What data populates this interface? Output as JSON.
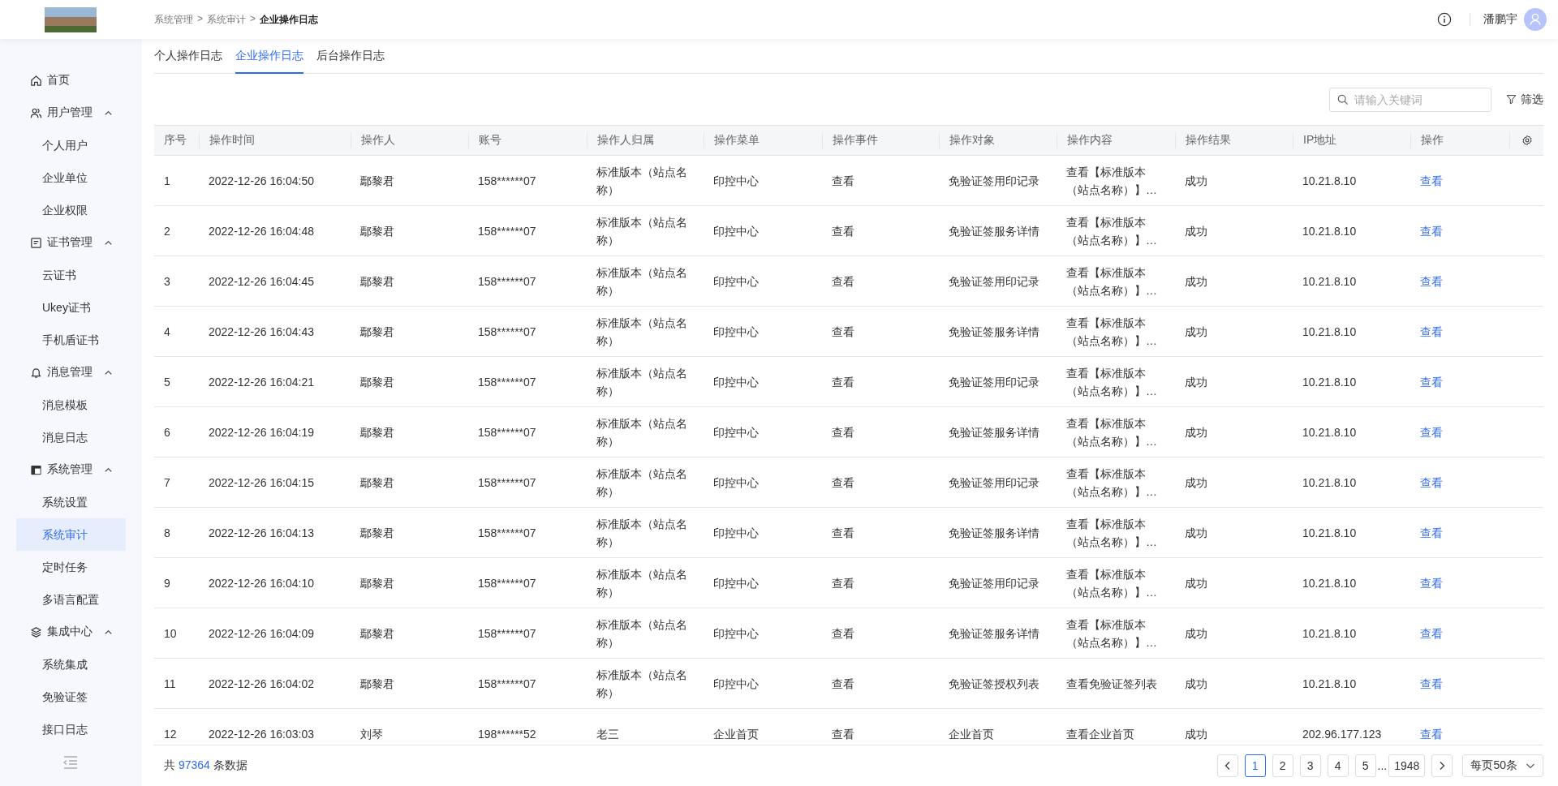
{
  "header": {
    "breadcrumb": [
      {
        "kind": "link",
        "label": "系统管理"
      },
      {
        "kind": "separator",
        "label": ">"
      },
      {
        "kind": "link",
        "label": "系统审计"
      },
      {
        "kind": "separator",
        "label": ">"
      },
      {
        "kind": "current",
        "label": "企业操作日志"
      }
    ],
    "user_name": "潘鹏宇"
  },
  "sidebar": {
    "items": [
      {
        "label": "首页",
        "selected": false
      },
      {
        "label": "用户管理",
        "expanded": true,
        "selected": false,
        "children": [
          {
            "label": "个人用户",
            "selected": false
          },
          {
            "label": "企业单位",
            "selected": false
          },
          {
            "label": "企业权限",
            "selected": false
          }
        ]
      },
      {
        "label": "证书管理",
        "expanded": true,
        "selected": false,
        "children": [
          {
            "label": "云证书",
            "selected": false
          },
          {
            "label": "Ukey证书",
            "selected": false
          },
          {
            "label": "手机盾证书",
            "selected": false
          }
        ]
      },
      {
        "label": "消息管理",
        "expanded": true,
        "selected": false,
        "children": [
          {
            "label": "消息模板",
            "selected": false
          },
          {
            "label": "消息日志",
            "selected": false
          }
        ]
      },
      {
        "label": "系统管理",
        "expanded": true,
        "selected": false,
        "children": [
          {
            "label": "系统设置",
            "selected": false
          },
          {
            "label": "系统审计",
            "selected": true
          },
          {
            "label": "定时任务",
            "selected": false
          },
          {
            "label": "多语言配置",
            "selected": false
          }
        ]
      },
      {
        "label": "集成中心",
        "expanded": true,
        "selected": false,
        "children": [
          {
            "label": "系统集成",
            "selected": false
          },
          {
            "label": "免验证签",
            "selected": false
          },
          {
            "label": "接口日志",
            "selected": false
          }
        ]
      }
    ]
  },
  "tabs": [
    {
      "label": "个人操作日志",
      "selected": false
    },
    {
      "label": "企业操作日志",
      "selected": true
    },
    {
      "label": "后台操作日志",
      "selected": false
    }
  ],
  "search": {
    "placeholder": "请输入关键词"
  },
  "filter_label": "筛选",
  "table": {
    "columns": [
      "序号",
      "操作时间",
      "操作人",
      "账号",
      "操作人归属",
      "操作菜单",
      "操作事件",
      "操作对象",
      "操作内容",
      "操作结果",
      "IP地址",
      "操作"
    ],
    "rows": [
      {
        "cells": [
          "1",
          "2022-12-26 16:04:50",
          "鄢黎君",
          "158******07",
          "标准版本（站点名称）",
          "印控中心",
          "查看",
          "免验证签用印记录",
          "查看【标准版本（站点名称）】…",
          "成功",
          "10.21.8.10"
        ],
        "action": "查看"
      },
      {
        "cells": [
          "2",
          "2022-12-26 16:04:48",
          "鄢黎君",
          "158******07",
          "标准版本（站点名称）",
          "印控中心",
          "查看",
          "免验证签服务详情",
          "查看【标准版本（站点名称）】…",
          "成功",
          "10.21.8.10"
        ],
        "action": "查看"
      },
      {
        "cells": [
          "3",
          "2022-12-26 16:04:45",
          "鄢黎君",
          "158******07",
          "标准版本（站点名称）",
          "印控中心",
          "查看",
          "免验证签用印记录",
          "查看【标准版本（站点名称）】…",
          "成功",
          "10.21.8.10"
        ],
        "action": "查看"
      },
      {
        "cells": [
          "4",
          "2022-12-26 16:04:43",
          "鄢黎君",
          "158******07",
          "标准版本（站点名称）",
          "印控中心",
          "查看",
          "免验证签服务详情",
          "查看【标准版本（站点名称）】…",
          "成功",
          "10.21.8.10"
        ],
        "action": "查看"
      },
      {
        "cells": [
          "5",
          "2022-12-26 16:04:21",
          "鄢黎君",
          "158******07",
          "标准版本（站点名称）",
          "印控中心",
          "查看",
          "免验证签用印记录",
          "查看【标准版本（站点名称）】…",
          "成功",
          "10.21.8.10"
        ],
        "action": "查看"
      },
      {
        "cells": [
          "6",
          "2022-12-26 16:04:19",
          "鄢黎君",
          "158******07",
          "标准版本（站点名称）",
          "印控中心",
          "查看",
          "免验证签服务详情",
          "查看【标准版本（站点名称）】…",
          "成功",
          "10.21.8.10"
        ],
        "action": "查看"
      },
      {
        "cells": [
          "7",
          "2022-12-26 16:04:15",
          "鄢黎君",
          "158******07",
          "标准版本（站点名称）",
          "印控中心",
          "查看",
          "免验证签用印记录",
          "查看【标准版本（站点名称）】…",
          "成功",
          "10.21.8.10"
        ],
        "action": "查看"
      },
      {
        "cells": [
          "8",
          "2022-12-26 16:04:13",
          "鄢黎君",
          "158******07",
          "标准版本（站点名称）",
          "印控中心",
          "查看",
          "免验证签服务详情",
          "查看【标准版本（站点名称）】…",
          "成功",
          "10.21.8.10"
        ],
        "action": "查看"
      },
      {
        "cells": [
          "9",
          "2022-12-26 16:04:10",
          "鄢黎君",
          "158******07",
          "标准版本（站点名称）",
          "印控中心",
          "查看",
          "免验证签用印记录",
          "查看【标准版本（站点名称）】…",
          "成功",
          "10.21.8.10"
        ],
        "action": "查看"
      },
      {
        "cells": [
          "10",
          "2022-12-26 16:04:09",
          "鄢黎君",
          "158******07",
          "标准版本（站点名称）",
          "印控中心",
          "查看",
          "免验证签服务详情",
          "查看【标准版本（站点名称）】…",
          "成功",
          "10.21.8.10"
        ],
        "action": "查看"
      },
      {
        "cells": [
          "11",
          "2022-12-26 16:04:02",
          "鄢黎君",
          "158******07",
          "标准版本（站点名称）",
          "印控中心",
          "查看",
          "免验证签授权列表",
          "查看免验证签列表",
          "成功",
          "10.21.8.10"
        ],
        "action": "查看"
      },
      {
        "cells": [
          "12",
          "2022-12-26 16:03:03",
          "刘琴",
          "198******52",
          "老三",
          "企业首页",
          "查看",
          "企业首页",
          "查看企业首页",
          "成功",
          "202.96.177.123"
        ],
        "action": "查看"
      }
    ]
  },
  "footer": {
    "total": {
      "prefix": "共",
      "count": "97364",
      "suffix": "条数据"
    },
    "pages": [
      {
        "label": "1",
        "selected": true
      },
      {
        "label": "2",
        "selected": false
      },
      {
        "label": "3",
        "selected": false
      },
      {
        "label": "4",
        "selected": false
      },
      {
        "label": "5",
        "selected": false
      }
    ],
    "ellipsis": "...",
    "last_page": "1948",
    "page_size": "每页50条"
  }
}
